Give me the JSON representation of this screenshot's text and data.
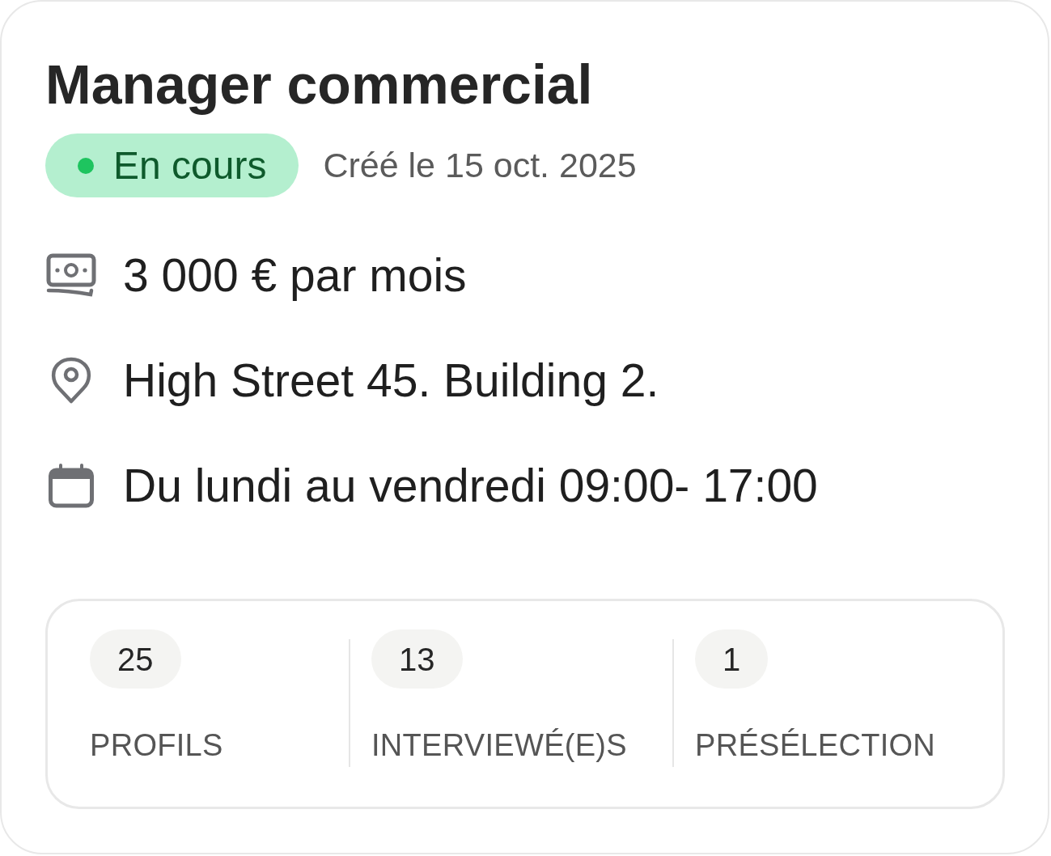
{
  "job": {
    "title": "Manager commercial",
    "status": {
      "label": "En cours"
    },
    "created": "Créé le 15 oct. 2025",
    "details": [
      {
        "kind": "salary",
        "text": "3 000 € par mois"
      },
      {
        "kind": "location",
        "text": "High Street 45. Building 2."
      },
      {
        "kind": "schedule",
        "text": "Du lundi au vendredi 09:00- 17:00"
      }
    ],
    "stats": [
      {
        "value": "25",
        "label": "PROFILS"
      },
      {
        "value": "13",
        "label": "INTERVIEWÉ(E)S"
      },
      {
        "value": "1",
        "label": "PRÉSÉLECTION"
      }
    ]
  }
}
